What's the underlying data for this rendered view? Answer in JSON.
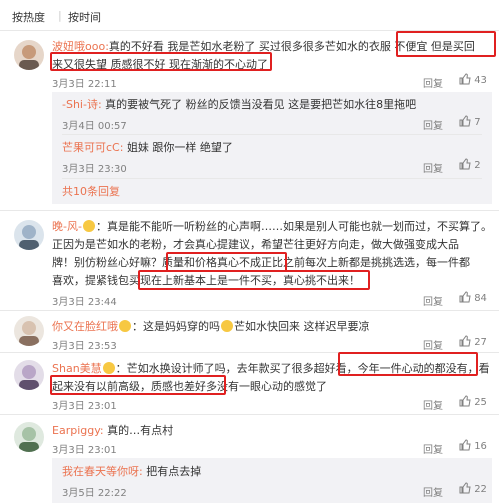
{
  "sort": {
    "hot": "按热度",
    "sep": "|",
    "time": "按时间"
  },
  "c1": {
    "user": "波妞哦ooo:",
    "text1": "真的不好看 我是芒如水老粉了 买过很多很多芒如水的衣服 ",
    "hl1": "不便宜 但是买回",
    "text2": "来又很失望 质感很不好 现在渐渐的不心动了",
    "date": "3月3日 22:11",
    "reply": "回复",
    "likes": "43"
  },
  "r1": {
    "user": "-Shi-诗:",
    "text": "真的要被气死了 粉丝的反馈当没看见 这是要把芒如水往8里拖吧",
    "date": "3月4日 00:57",
    "reply": "回复",
    "likes": "7"
  },
  "r2": {
    "user": "芒果可可cC:",
    "text": "姐妹 跟你一样 绝望了",
    "date": "3月3日 23:30",
    "reply": "回复",
    "likes": "2"
  },
  "more": "共10条回复",
  "c2": {
    "user": "晚-风-",
    "line1": "：真是能不能听一听粉丝的心声啊……如果是别人可能也就一划而过，不买算了。",
    "line2": "正因为是芒如水的老粉，才会真心提建议，希望芒往更好方向走，做大做强变成大品",
    "line3a": "牌！别仿粉丝心好嘛？",
    "line3hl": "质量和价格真心不成正比",
    "line3b": "之前每次上新都是挑挑选选，每一件都",
    "line4a": "喜欢，提紧钱包买",
    "line4hl": "现在上新基本上是一件不买，真心挑不出来！",
    "date": "3月3日 23:44",
    "reply": "回复",
    "likes": "84"
  },
  "c3": {
    "user": "你又在脸红哦",
    "text": "：这是妈妈穿的吗",
    "text2": "芒如水快回来 这样迟早要凉",
    "date": "3月3日 23:53",
    "reply": "回复",
    "likes": "27"
  },
  "c4": {
    "user": "Shan美慧",
    "line1a": "：芒如水换设计师了吗，去年款买了很多超好看，",
    "line1hl": "今年一件心动的都没有，看",
    "line2hl": "起来没有以前高级，质感也差好多",
    "line2b": "没有一眼心动的感觉了",
    "date": "3月3日 23:01",
    "reply": "回复",
    "likes": "25"
  },
  "c5": {
    "user": "Earpiggy:",
    "text": "真的…有点村",
    "date": "3月3日 23:01",
    "reply": "回复",
    "likes": "16"
  },
  "r3": {
    "user": "我在春天等你呀:",
    "text": "把有点去掉",
    "date": "3月5日 22:22",
    "reply": "回复",
    "likes": "22"
  }
}
